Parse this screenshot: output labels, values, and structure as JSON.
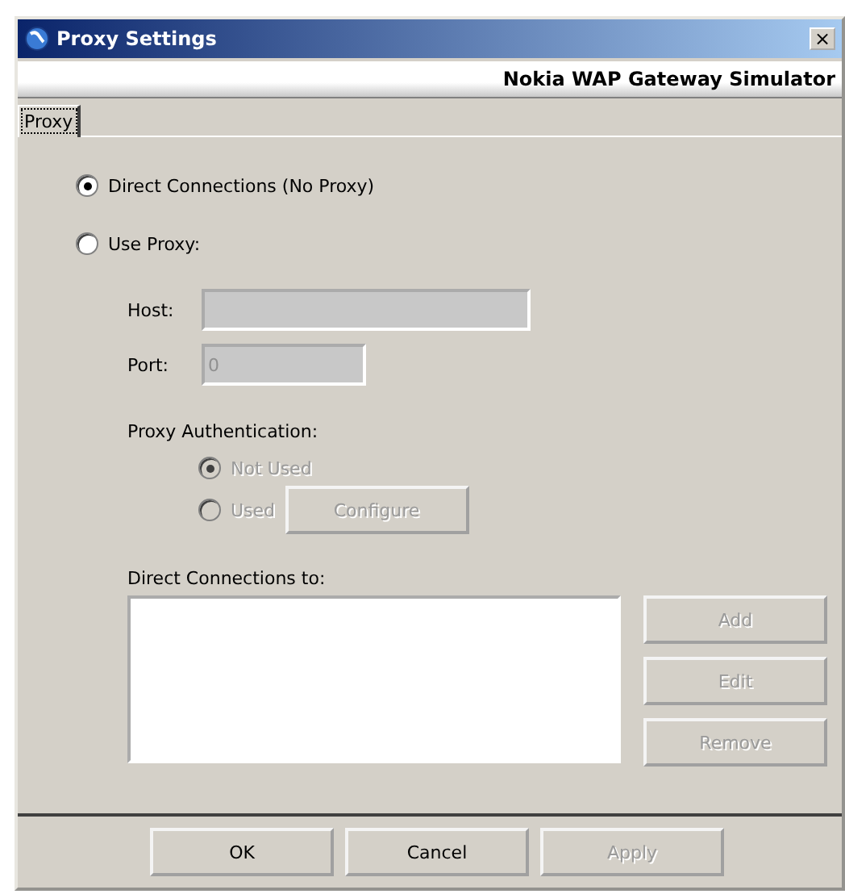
{
  "window": {
    "title": "Proxy Settings",
    "close": "×"
  },
  "banner": "Nokia WAP Gateway Simulator",
  "tabs": [
    {
      "label": "Proxy",
      "selected": true
    }
  ],
  "connection_options": [
    {
      "label": "Direct Connections (No Proxy)",
      "selected": true
    },
    {
      "label": "Use Proxy:",
      "selected": false
    }
  ],
  "host": {
    "label": "Host:",
    "disabled": true
  },
  "port": {
    "label": "Port:",
    "value": "0",
    "disabled": true
  },
  "auth": {
    "label": "Proxy Authentication:",
    "options": [
      {
        "label": "Not Used",
        "selected": true,
        "disabled": true
      },
      {
        "label": "Used",
        "selected": false,
        "disabled": true
      }
    ],
    "configure": {
      "label": "Configure",
      "disabled": true
    }
  },
  "direct_list": {
    "label": "Direct Connections to:",
    "buttons": [
      {
        "label": "Add",
        "disabled": true
      },
      {
        "label": "Edit",
        "disabled": true
      },
      {
        "label": "Remove",
        "disabled": true
      }
    ]
  },
  "footer_buttons": [
    {
      "label": "OK",
      "disabled": false
    },
    {
      "label": "Cancel",
      "disabled": false
    },
    {
      "label": "Apply",
      "disabled": true
    }
  ]
}
